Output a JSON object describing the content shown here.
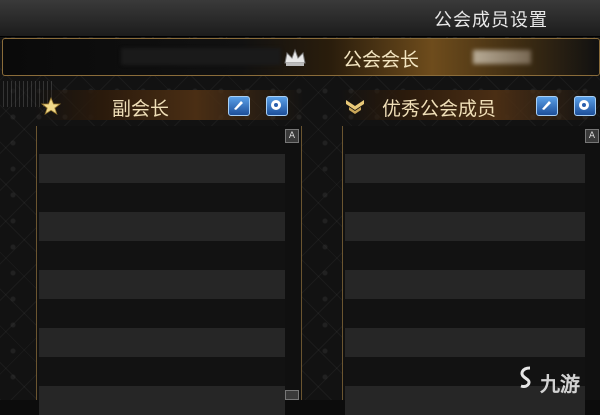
{
  "window": {
    "title": "公会成员设置"
  },
  "leader": {
    "label": "公会会长"
  },
  "sections": [
    {
      "title": "副会长",
      "icon": "star-icon",
      "rows": 9
    },
    {
      "title": "优秀公会成员",
      "icon": "chevron-icon",
      "rows": 9
    }
  ],
  "buttons": {
    "edit": "edit-icon",
    "settings": "gear-icon"
  },
  "scroll": {
    "up_glyph": "A"
  },
  "watermark": {
    "text": "九游"
  },
  "colors": {
    "gold_text": "#f0dfb8",
    "button_blue": "#2f72c8",
    "border_gold": "#8a6c3a"
  }
}
